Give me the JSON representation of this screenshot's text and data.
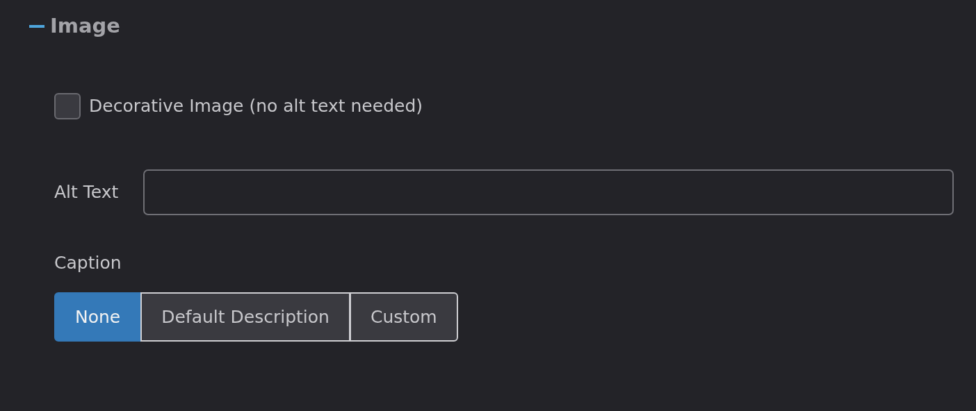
{
  "section": {
    "title": "Image",
    "expanded": true
  },
  "decorative": {
    "label": "Decorative Image (no alt text needed)",
    "checked": false
  },
  "alt_text": {
    "label": "Alt Text"
  },
  "caption": {
    "label": "Caption",
    "options": [
      {
        "label": "None",
        "selected": true
      },
      {
        "label": "Default Description",
        "selected": false
      },
      {
        "label": "Custom",
        "selected": false
      }
    ]
  }
}
